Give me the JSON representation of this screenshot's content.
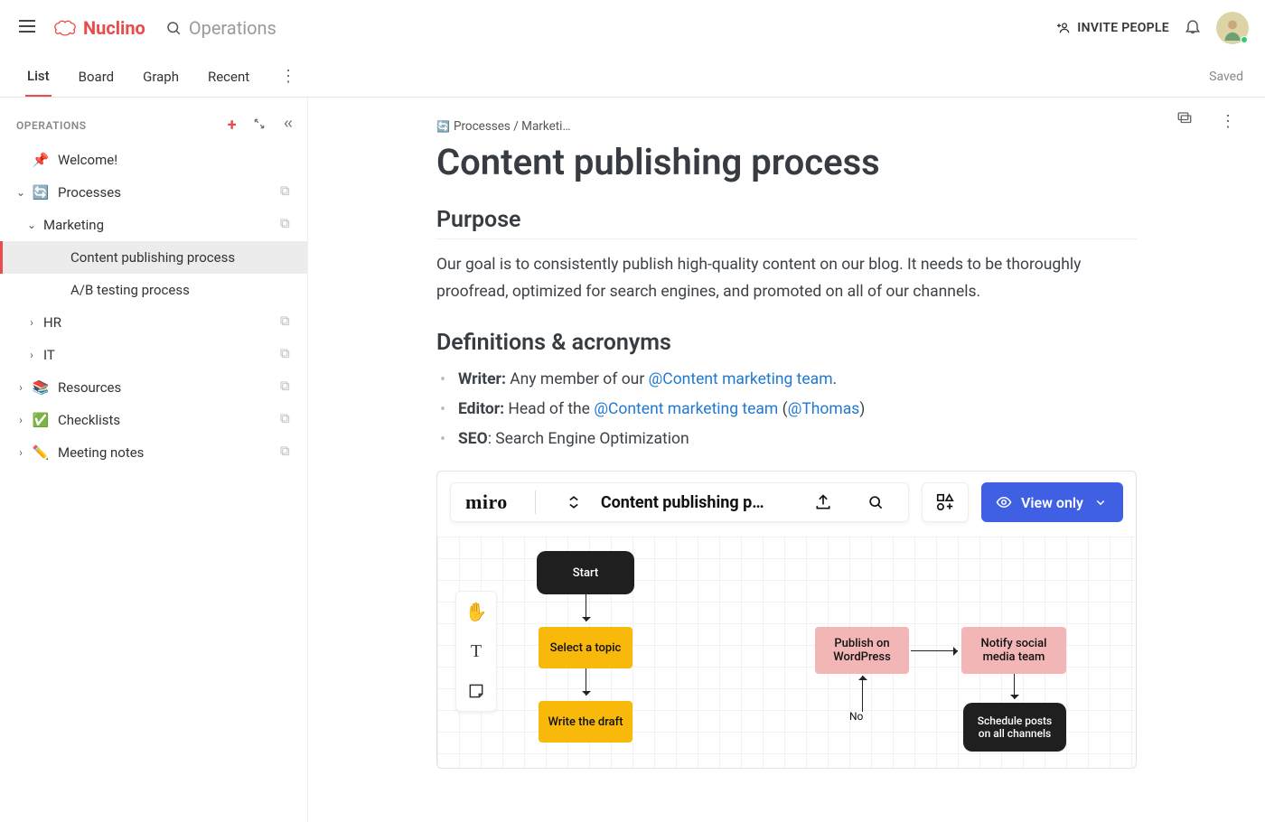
{
  "app": {
    "name": "Nuclino"
  },
  "header": {
    "search_placeholder": "Operations",
    "invite_label": "INVITE PEOPLE"
  },
  "viewbar": {
    "tabs": [
      "List",
      "Board",
      "Graph",
      "Recent"
    ],
    "active": "List",
    "saved_label": "Saved"
  },
  "sidebar": {
    "title": "OPERATIONS",
    "items": [
      {
        "icon": "📌",
        "label": "Welcome!",
        "level": 0,
        "caret": ""
      },
      {
        "icon": "🔄",
        "label": "Processes",
        "level": 0,
        "caret": "v",
        "stack": true
      },
      {
        "icon": "",
        "label": "Marketing",
        "level": 1,
        "caret": "v",
        "stack": true
      },
      {
        "icon": "",
        "label": "Content publishing process",
        "level": 2,
        "caret": "",
        "active": true
      },
      {
        "icon": "",
        "label": "A/B testing process",
        "level": 2,
        "caret": ""
      },
      {
        "icon": "",
        "label": "HR",
        "level": 1,
        "caret": ">",
        "stack": true
      },
      {
        "icon": "",
        "label": "IT",
        "level": 1,
        "caret": ">",
        "stack": true
      },
      {
        "icon": "📚",
        "label": "Resources",
        "level": 0,
        "caret": ">",
        "stack": true
      },
      {
        "icon": "✅",
        "label": "Checklists",
        "level": 0,
        "caret": ">",
        "stack": true
      },
      {
        "icon": "✏️",
        "label": "Meeting notes",
        "level": 0,
        "caret": ">",
        "stack": true
      }
    ]
  },
  "breadcrumb": {
    "icon": "🔄",
    "path": "Processes / Marketi…"
  },
  "doc": {
    "title": "Content publishing process",
    "sections": {
      "purpose_heading": "Purpose",
      "purpose_text": "Our goal is to consistently publish high-quality content on our blog. It needs to be thoroughly proofread, optimized for search engines, and promoted on all of our channels.",
      "defs_heading": "Definitions & acronyms",
      "defs": [
        {
          "term": "Writer:",
          "rest_a": " Any member of our ",
          "m1": "@Content marketing team",
          "rest_b": "."
        },
        {
          "term": "Editor:",
          "rest_a": " Head of the ",
          "m1": "@Content marketing team",
          "rest_b": " (",
          "m2": "@Thomas",
          "rest_c": ")"
        },
        {
          "term": "SEO",
          "rest_a": ": Search Engine Optimization"
        }
      ]
    }
  },
  "miro": {
    "brand": "miro",
    "title": "Content publishing p…",
    "view_only_label": "View only",
    "nodes": {
      "start": "Start",
      "select": "Select a topic",
      "draft": "Write the draft",
      "publish": "Publish on WordPress",
      "notify": "Notify social media team",
      "schedule": "Schedule posts on all channels",
      "no_label": "No"
    }
  }
}
